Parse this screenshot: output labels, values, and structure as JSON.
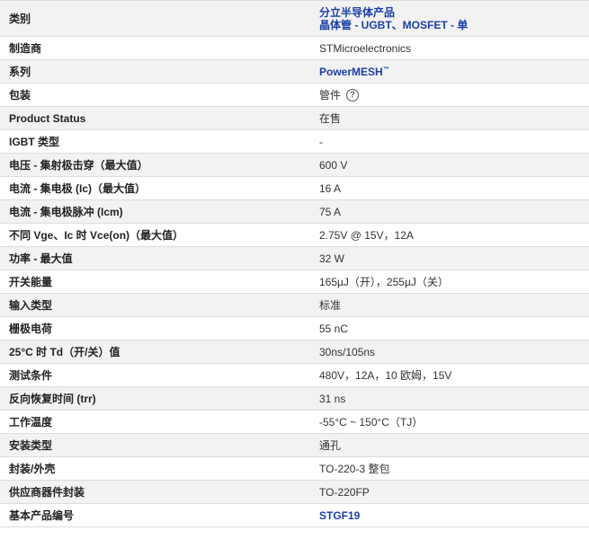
{
  "specs": {
    "category": {
      "label": "类别",
      "line1": "分立半导体产品",
      "line2": "晶体管 - UGBT、MOSFET - 单"
    },
    "rows": [
      {
        "label": "制造商",
        "value": "STMicroelectronics"
      },
      {
        "label": "系列",
        "value": "PowerMESH",
        "suffix": "™"
      },
      {
        "label": "包装",
        "value": "管件"
      },
      {
        "label": "Product Status",
        "value": "在售"
      },
      {
        "label": "IGBT 类型",
        "value": "-"
      },
      {
        "label": "电压 - 集射极击穿（最大值）",
        "value": "600 V"
      },
      {
        "label": "电流 - 集电极 (Ic)（最大值）",
        "value": "16 A"
      },
      {
        "label": "电流 - 集电极脉冲 (Icm)",
        "value": "75 A"
      },
      {
        "label": "不同 Vge、Ic 时 Vce(on)（最大值）",
        "value": "2.75V @ 15V，12A"
      },
      {
        "label": "功率 - 最大值",
        "value": "32 W"
      },
      {
        "label": "开关能量",
        "value": "165µJ（开），255µJ（关）"
      },
      {
        "label": "输入类型",
        "value": "标准"
      },
      {
        "label": "栅极电荷",
        "value": "55 nC"
      },
      {
        "label": "25°C 时 Td（开/关）值",
        "value": "30ns/105ns"
      },
      {
        "label": "测试条件",
        "value": "480V，12A，10 欧姆，15V"
      },
      {
        "label": "反向恢复时间 (trr)",
        "value": "31 ns"
      },
      {
        "label": "工作温度",
        "value": "-55°C ~ 150°C（TJ）"
      },
      {
        "label": "安装类型",
        "value": "通孔"
      },
      {
        "label": "封装/外壳",
        "value": "TO-220-3 整包"
      },
      {
        "label": "供应商器件封装",
        "value": "TO-220FP"
      },
      {
        "label": "基本产品编号",
        "value": "STGF19"
      }
    ],
    "help_icon_glyph": "?"
  },
  "colors": {
    "link": "#1b3fa6",
    "row_alt": "#f2f2f2",
    "border": "#dcdcdc"
  }
}
